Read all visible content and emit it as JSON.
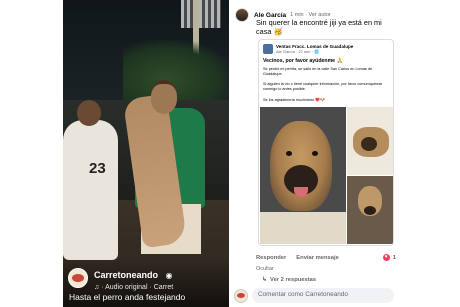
{
  "video": {
    "jersey_number": "23",
    "channel_name": "Carretoneando",
    "verified_icon": "verified-badge-icon",
    "audio_icon": "music-note-icon",
    "audio_label": "♫ · Audio original · Carret",
    "caption": "Hasta el perro anda festejando"
  },
  "comment": {
    "author": "Ale García",
    "meta": "1 min · Ver autor",
    "text": "Sin querer la encontré jiji ya está en mi casa 🥳"
  },
  "shared_post": {
    "page_name": "Ventas Fracc. Lomas de Guadalupe",
    "meta": "Ale García · 27 min · 🌐",
    "title": "Vecinos, por favor ayúdenme 🙏",
    "body1": "Se perdió mi perrita, se salió en la calle San Carlos en Lomas de Guadalupe.",
    "body2": "Si alguien la vio o tiene cualquier información, por favor comuníquense conmigo lo antes posible.",
    "body3": "Se los agradecería muchísimo ❤️🐶"
  },
  "actions": {
    "reply": "Responder",
    "send_message": "Enviar mensaje",
    "reaction_count": "1",
    "hide": "Ocultar",
    "view_replies": "Ver 2 respuestas"
  },
  "comment_box": {
    "placeholder": "Comentar como Carretoneando"
  },
  "colors": {
    "facebook_gray": "#65676b",
    "heart_red": "#f33e58",
    "jersey_green": "#1f7a4a"
  }
}
